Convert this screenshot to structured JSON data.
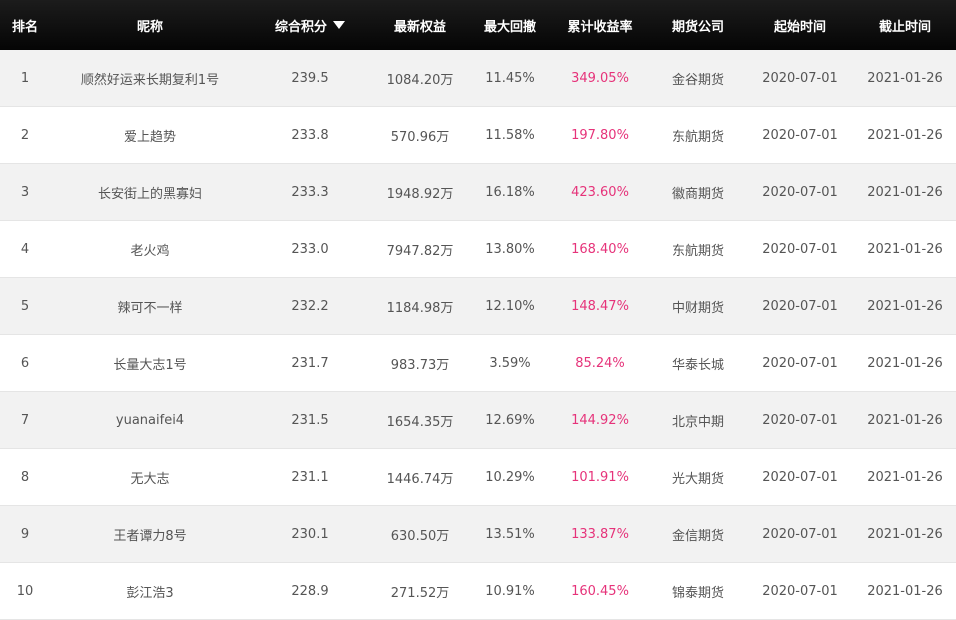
{
  "headers": {
    "rank": "排名",
    "nickname": "昵称",
    "score": "综合积分",
    "equity": "最新权益",
    "drawdown": "最大回撤",
    "return": "累计收益率",
    "company": "期货公司",
    "start": "起始时间",
    "end": "截止时间"
  },
  "colors": {
    "header_bg": "#0d0d0d",
    "return_text": "#e6337a"
  },
  "rows": [
    {
      "rank": "1",
      "nickname": "顺然好运来长期复利1号",
      "score": "239.5",
      "equity": "1084.20万",
      "drawdown": "11.45%",
      "return": "349.05%",
      "company": "金谷期货",
      "start": "2020-07-01",
      "end": "2021-01-26"
    },
    {
      "rank": "2",
      "nickname": "爱上趋势",
      "score": "233.8",
      "equity": "570.96万",
      "drawdown": "11.58%",
      "return": "197.80%",
      "company": "东航期货",
      "start": "2020-07-01",
      "end": "2021-01-26"
    },
    {
      "rank": "3",
      "nickname": "长安街上的黑寡妇",
      "score": "233.3",
      "equity": "1948.92万",
      "drawdown": "16.18%",
      "return": "423.60%",
      "company": "徽商期货",
      "start": "2020-07-01",
      "end": "2021-01-26"
    },
    {
      "rank": "4",
      "nickname": "老火鸡",
      "score": "233.0",
      "equity": "7947.82万",
      "drawdown": "13.80%",
      "return": "168.40%",
      "company": "东航期货",
      "start": "2020-07-01",
      "end": "2021-01-26"
    },
    {
      "rank": "5",
      "nickname": "辣可不一样",
      "score": "232.2",
      "equity": "1184.98万",
      "drawdown": "12.10%",
      "return": "148.47%",
      "company": "中财期货",
      "start": "2020-07-01",
      "end": "2021-01-26"
    },
    {
      "rank": "6",
      "nickname": "长量大志1号",
      "score": "231.7",
      "equity": "983.73万",
      "drawdown": "3.59%",
      "return": "85.24%",
      "company": "华泰长城",
      "start": "2020-07-01",
      "end": "2021-01-26"
    },
    {
      "rank": "7",
      "nickname": "yuanaifei4",
      "score": "231.5",
      "equity": "1654.35万",
      "drawdown": "12.69%",
      "return": "144.92%",
      "company": "北京中期",
      "start": "2020-07-01",
      "end": "2021-01-26"
    },
    {
      "rank": "8",
      "nickname": "无大志",
      "score": "231.1",
      "equity": "1446.74万",
      "drawdown": "10.29%",
      "return": "101.91%",
      "company": "光大期货",
      "start": "2020-07-01",
      "end": "2021-01-26"
    },
    {
      "rank": "9",
      "nickname": "王者谭力8号",
      "score": "230.1",
      "equity": "630.50万",
      "drawdown": "13.51%",
      "return": "133.87%",
      "company": "金信期货",
      "start": "2020-07-01",
      "end": "2021-01-26"
    },
    {
      "rank": "10",
      "nickname": "彭江浩3",
      "score": "228.9",
      "equity": "271.52万",
      "drawdown": "10.91%",
      "return": "160.45%",
      "company": "锦泰期货",
      "start": "2020-07-01",
      "end": "2021-01-26"
    }
  ]
}
